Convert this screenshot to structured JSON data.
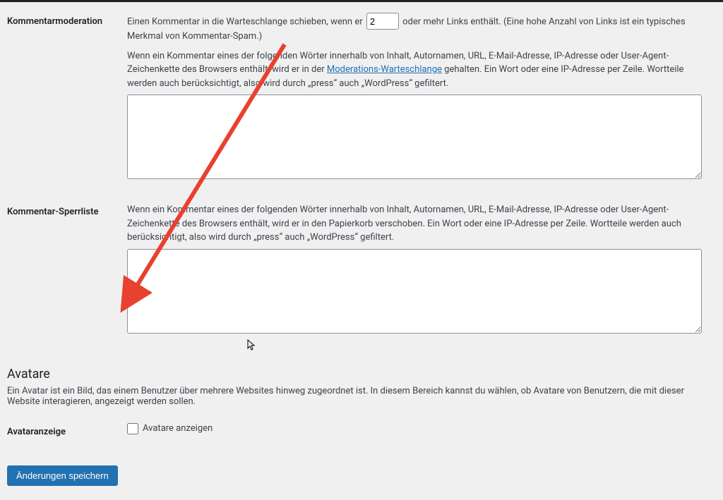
{
  "moderation": {
    "label": "Kommentarmoderation",
    "queue_text_before": "Einen Kommentar in die Warteschlange schieben, wenn er",
    "queue_value": "2",
    "queue_text_after": "oder mehr Links enthält. (Eine hohe Anzahl von Links ist ein typisches Merkmal von Kommentar-Spam.)",
    "desc_before_link": "Wenn ein Kommentar eines der folgenden Wörter innerhalb von Inhalt, Autornamen, URL, E-Mail-Adresse, IP-Adresse oder User-Agent-Zeichenkette des Browsers enthält, wird er in der ",
    "desc_link": "Moderations-Warteschlange",
    "desc_after_link": " gehalten. Ein Wort oder eine IP-Adresse per Zeile. Wortteile werden auch berücksichtigt, also wird durch „press“ auch „WordPress“ gefiltert."
  },
  "blocklist": {
    "label": "Kommentar-Sperrliste",
    "desc": "Wenn ein Kommentar eines der folgenden Wörter innerhalb von Inhalt, Autornamen, URL, E-Mail-Adresse, IP-Adresse oder User-Agent-Zeichenkette des Browsers enthält, wird er in den Papierkorb verschoben. Ein Wort oder eine IP-Adresse per Zeile. Wortteile werden auch berücksichtigt, also wird durch „press“ auch „WordPress“ gefiltert."
  },
  "avatars": {
    "section_title": "Avatare",
    "intro": "Ein Avatar ist ein Bild, das einem Benutzer über mehrere Websites hinweg zugeordnet ist. In diesem Bereich kannst du wählen, ob Avatare von Benutzern, die mit dieser Website interagieren, angezeigt werden sollen.",
    "display_label": "Avataranzeige",
    "checkbox_label": "Avatare anzeigen"
  },
  "submit_label": "Änderungen speichern"
}
